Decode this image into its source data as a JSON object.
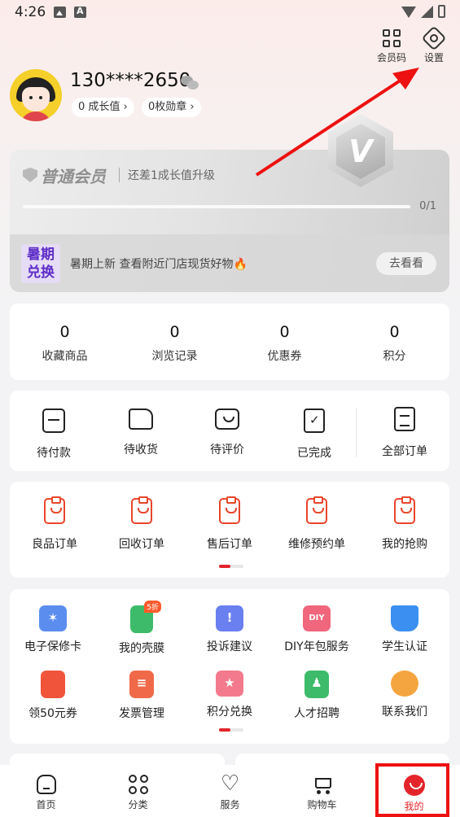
{
  "status_bar": {
    "time": "4:26"
  },
  "top_actions": {
    "member_code": "会员码",
    "settings": "设置"
  },
  "profile": {
    "phone": "130****2650",
    "growth": "0 成长值 ›",
    "medals": "0枚勋章 ›"
  },
  "member_card": {
    "level": "普通会员",
    "upgrade_tip": "还差1成长值升级",
    "progress_text": "0/1",
    "progress": 0,
    "badge_letter": "V",
    "promo_badge": [
      "暑期",
      "兑换"
    ],
    "promo_text": "暑期上新  查看附近门店现货好物🔥",
    "promo_button": "去看看"
  },
  "stats": [
    {
      "value": "0",
      "label": "收藏商品"
    },
    {
      "value": "0",
      "label": "浏览记录"
    },
    {
      "value": "0",
      "label": "优惠券"
    },
    {
      "value": "0",
      "label": "积分"
    }
  ],
  "orders": [
    "待付款",
    "待收货",
    "待评价",
    "已完成",
    "全部订单"
  ],
  "services": [
    "良品订单",
    "回收订单",
    "售后订单",
    "维修预约单",
    "我的抢购"
  ],
  "tools": [
    {
      "label": "电子保修卡",
      "icon": "warranty-card-icon",
      "color": "#5b8def"
    },
    {
      "label": "我的壳膜",
      "icon": "phone-case-icon",
      "color": "#3dbb6a",
      "badge": "5折"
    },
    {
      "label": "投诉建议",
      "icon": "complaint-icon",
      "color": "#6a7ff0"
    },
    {
      "label": "DIY年包服务",
      "icon": "diy-box-icon",
      "color": "#f0667c",
      "glyph": "DIY"
    },
    {
      "label": "学生认证",
      "icon": "graduation-cap-icon",
      "color": "#3a8ff0"
    },
    {
      "label": "领50元券",
      "icon": "coupon-icon",
      "color": "#f0553c"
    },
    {
      "label": "发票管理",
      "icon": "invoice-icon",
      "color": "#f06a4a"
    },
    {
      "label": "积分兑换",
      "icon": "gift-icon",
      "color": "#f27a8c"
    },
    {
      "label": "人才招聘",
      "icon": "recruit-icon",
      "color": "#3dbb6a"
    },
    {
      "label": "联系我们",
      "icon": "headset-icon",
      "color": "#f5a540"
    }
  ],
  "nav": [
    {
      "label": "首页",
      "icon": "home-icon"
    },
    {
      "label": "分类",
      "icon": "category-icon"
    },
    {
      "label": "服务",
      "icon": "service-heart-icon"
    },
    {
      "label": "购物车",
      "icon": "cart-icon"
    },
    {
      "label": "我的",
      "icon": "me-icon",
      "active": true
    }
  ],
  "colors": {
    "accent": "#e3242b",
    "annotation": "#e11111"
  }
}
